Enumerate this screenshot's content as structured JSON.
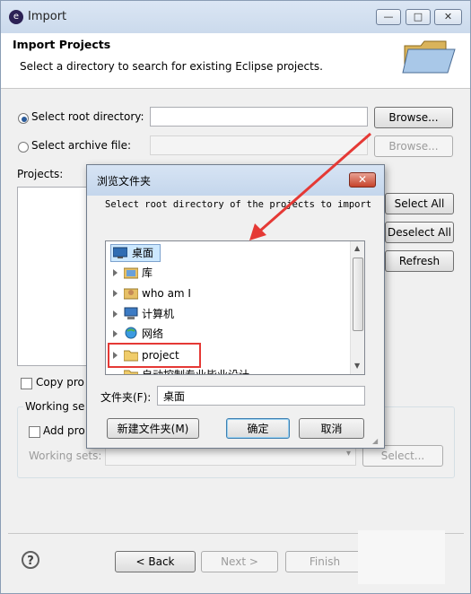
{
  "window": {
    "title": "Import",
    "controls": {
      "minimize": "—",
      "maximize": "□",
      "close": "✕"
    }
  },
  "header": {
    "title": "Import Projects",
    "description": "Select a directory to search for existing Eclipse projects."
  },
  "source": {
    "root_label": "Select root directory:",
    "root_value": "",
    "root_browse": "Browse...",
    "archive_label": "Select archive file:",
    "archive_value": "",
    "archive_browse": "Browse..."
  },
  "projects": {
    "label": "Projects:",
    "select_all": "Select All",
    "deselect_all": "Deselect All",
    "refresh": "Refresh"
  },
  "options": {
    "copy_label": "Copy pro",
    "working_sets_group": "Working se",
    "add_label": "Add pro",
    "working_sets_label": "Working sets:",
    "working_sets_select": "Select..."
  },
  "footer": {
    "help": "?",
    "back": "< Back",
    "next": "Next >",
    "finish": "Finish"
  },
  "dialog": {
    "title": "浏览文件夹",
    "close": "✕",
    "prompt": "Select root directory of the projects to import",
    "tree": [
      {
        "label": "桌面",
        "icon": "desktop-icon",
        "selected": true
      },
      {
        "label": "库",
        "icon": "library-icon"
      },
      {
        "label": "who am I",
        "icon": "user-folder-icon"
      },
      {
        "label": "计算机",
        "icon": "computer-icon"
      },
      {
        "label": "网络",
        "icon": "network-icon"
      },
      {
        "label": "project",
        "icon": "folder-icon",
        "highlighted": true
      },
      {
        "label": "自动控制专业毕业设计",
        "icon": "folder-icon"
      }
    ],
    "folder_label": "文件夹(F):",
    "folder_value": "桌面",
    "new_folder": "新建文件夹(M)",
    "ok": "确定",
    "cancel": "取消"
  },
  "colors": {
    "annotation_red": "#e53935",
    "selection_blue": "#cce8ff"
  }
}
